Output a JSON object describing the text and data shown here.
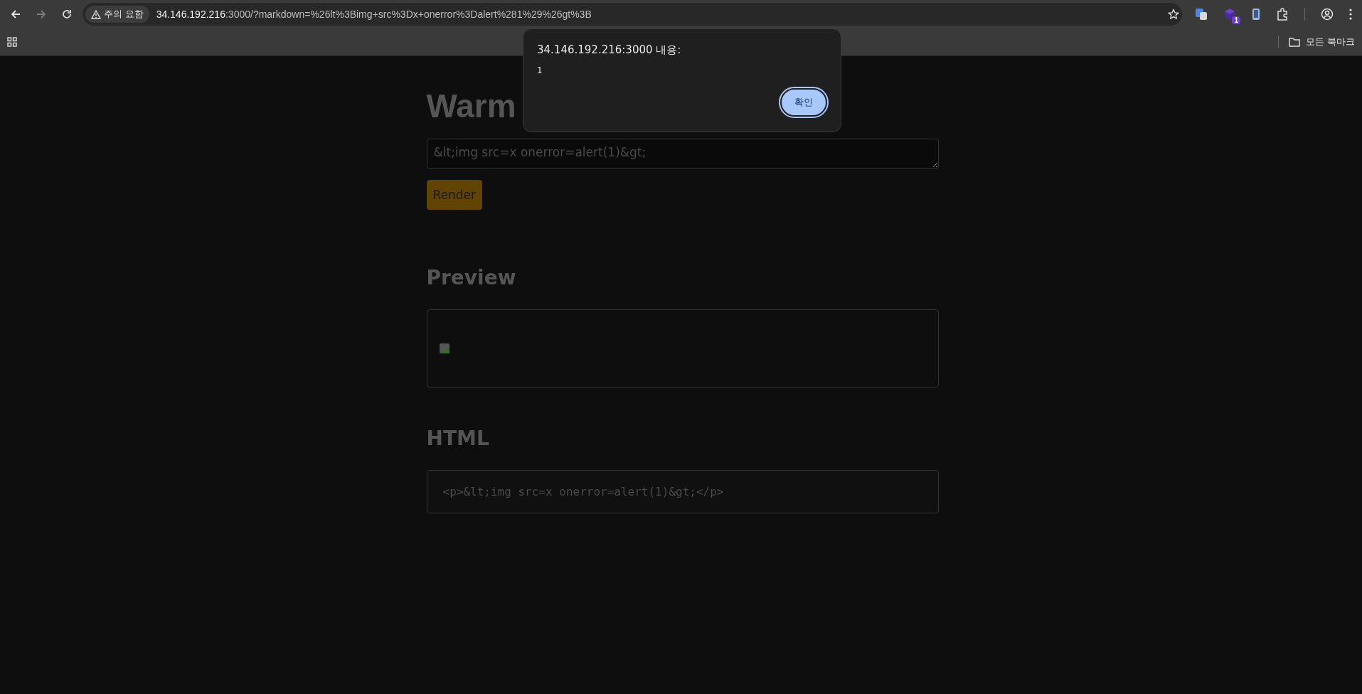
{
  "browser": {
    "back_disabled": false,
    "forward_disabled": true,
    "security_chip": "주의 요함",
    "url_host": "34.146.192.216",
    "url_rest": ":3000/?markdown=%26lt%3Bimg+src%3Dx+onerror%3Dalert%281%29%26gt%3B",
    "extension_badge": "1",
    "bookmarks_folder": "모든 북마크"
  },
  "page": {
    "title": "Warm",
    "input_value": "&lt;img src=x onerror=alert(1)&gt;",
    "render_button": "Render",
    "preview_heading": "Preview",
    "html_heading": "HTML",
    "html_code": "<p>&lt;img src=x onerror=alert(1)&gt;</p>"
  },
  "dialog": {
    "title": "34.146.192.216:3000 내용:",
    "message": "1",
    "ok_button": "확인"
  }
}
